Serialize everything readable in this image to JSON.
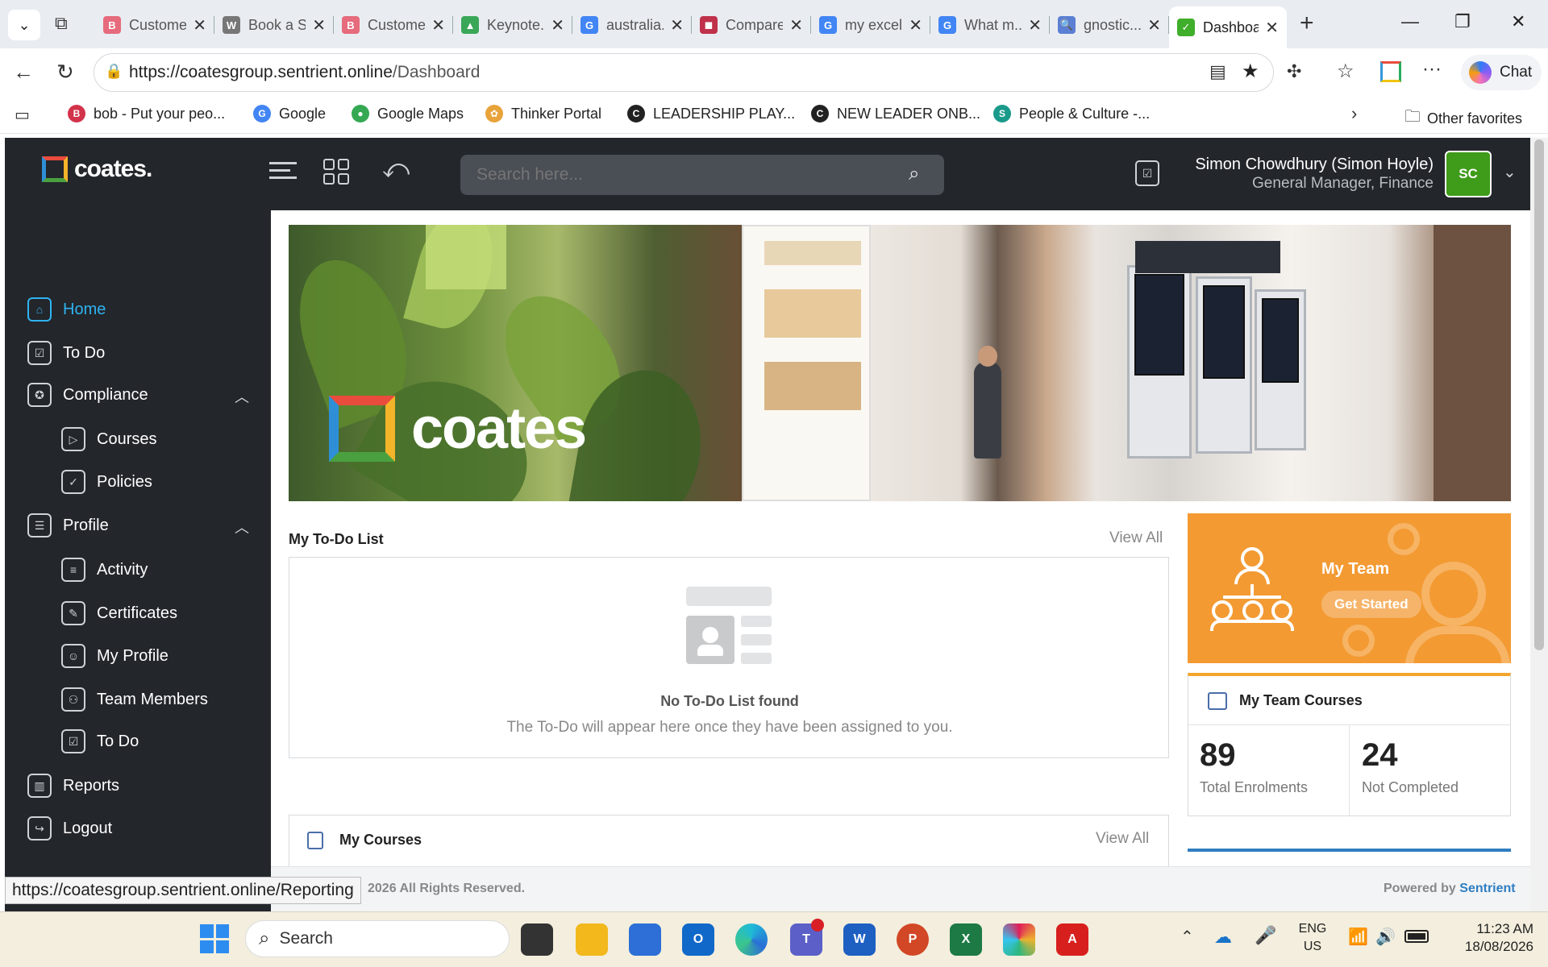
{
  "browser": {
    "tabs": [
      {
        "title": "Customer...",
        "fav": "B",
        "color": "#e66b7c"
      },
      {
        "title": "Book a Se...",
        "fav": "W",
        "color": "#777777"
      },
      {
        "title": "Customer...",
        "fav": "B",
        "color": "#e66b7c"
      },
      {
        "title": "Keynote...",
        "fav": "▲",
        "color": "#3aa757"
      },
      {
        "title": "australia...",
        "fav": "G",
        "color": "#4285f4"
      },
      {
        "title": "Compare...",
        "fav": "◼",
        "color": "#c0314b"
      },
      {
        "title": "my excel...",
        "fav": "G",
        "color": "#4285f4"
      },
      {
        "title": "What m...",
        "fav": "G",
        "color": "#4285f4"
      },
      {
        "title": "gnostic...",
        "fav": "🔍",
        "color": "#5b7fd3"
      },
      {
        "title": "Dashboard",
        "fav": "✓",
        "color": "#3fae2a"
      }
    ],
    "url_host": "https://coatesgroup.sentrient.online",
    "url_path": "/Dashboard",
    "chat_label": "Chat",
    "favorites": [
      {
        "label": "bob - Put your peo...",
        "color": "#d2324a",
        "ic": "B"
      },
      {
        "label": "Google",
        "color": "#4285f4",
        "ic": "G"
      },
      {
        "label": "Google Maps",
        "color": "#34a853",
        "ic": "●"
      },
      {
        "label": "Thinker Portal",
        "color": "#e8a33a",
        "ic": "✿"
      },
      {
        "label": "LEADERSHIP PLAY...",
        "color": "#222222",
        "ic": "C"
      },
      {
        "label": "NEW LEADER ONB...",
        "color": "#222222",
        "ic": "C"
      },
      {
        "label": "People & Culture -...",
        "color": "#1a9a8a",
        "ic": "S"
      }
    ],
    "other_favorites": "Other favorites",
    "status_url": "https://coatesgroup.sentrient.online/Reporting"
  },
  "app": {
    "brand": "coates.",
    "search_placeholder": "Search here...",
    "user_name": "Simon Chowdhury (Simon Hoyle)",
    "user_role": "General Manager, Finance",
    "avatar": "SC",
    "sidebar": [
      {
        "label": "Home",
        "icon": "home-icon",
        "glyph": "⌂",
        "sub": false,
        "active": true
      },
      {
        "label": "To Do",
        "icon": "todo-icon",
        "glyph": "☑",
        "sub": false
      },
      {
        "label": "Compliance",
        "icon": "compliance-icon",
        "glyph": "✪",
        "sub": false,
        "chev": true
      },
      {
        "label": "Courses",
        "icon": "courses-icon",
        "glyph": "▷",
        "sub": true
      },
      {
        "label": "Policies",
        "icon": "shield-icon",
        "glyph": "✓",
        "sub": true
      },
      {
        "label": "Profile",
        "icon": "profile-icon",
        "glyph": "☰",
        "sub": false,
        "chev": true
      },
      {
        "label": "Activity",
        "icon": "activity-icon",
        "glyph": "≡",
        "sub": true
      },
      {
        "label": "Certificates",
        "icon": "certificate-icon",
        "glyph": "✎",
        "sub": true
      },
      {
        "label": "My Profile",
        "icon": "my-profile-icon",
        "glyph": "☺",
        "sub": true
      },
      {
        "label": "Team Members",
        "icon": "team-members-icon",
        "glyph": "⚇",
        "sub": true
      },
      {
        "label": "To Do",
        "icon": "todo-icon",
        "glyph": "☑",
        "sub": true
      },
      {
        "label": "Reports",
        "icon": "reports-icon",
        "glyph": "▥",
        "sub": false
      },
      {
        "label": "Logout",
        "icon": "logout-icon",
        "glyph": "↪",
        "sub": false
      }
    ],
    "banner_logo": "coates",
    "todo": {
      "title": "My To-Do List",
      "view_all": "View All",
      "empty_title": "No To-Do List found",
      "empty_text": "The To-Do will appear here once they have been assigned to you."
    },
    "team": {
      "title": "My Team",
      "button": "Get Started"
    },
    "team_courses": {
      "title": "My Team Courses",
      "total": "89",
      "total_label": "Total Enrolments",
      "not_completed": "24",
      "not_completed_label": "Not Completed"
    },
    "courses": {
      "title": "My Courses",
      "view_all": "View All"
    },
    "footer_left": "2026 All Rights Reserved.",
    "footer_powered": "Powered by",
    "footer_brand": "Sentrient"
  },
  "taskbar": {
    "search": "Search",
    "lang1": "ENG",
    "lang2": "US",
    "time": "11:23 AM",
    "date": "18/08/2026"
  },
  "colors": {
    "accent": "#2fb3f0",
    "orange": "#f39a33",
    "avatar_green": "#3f9b1a",
    "dark": "#23262b"
  }
}
